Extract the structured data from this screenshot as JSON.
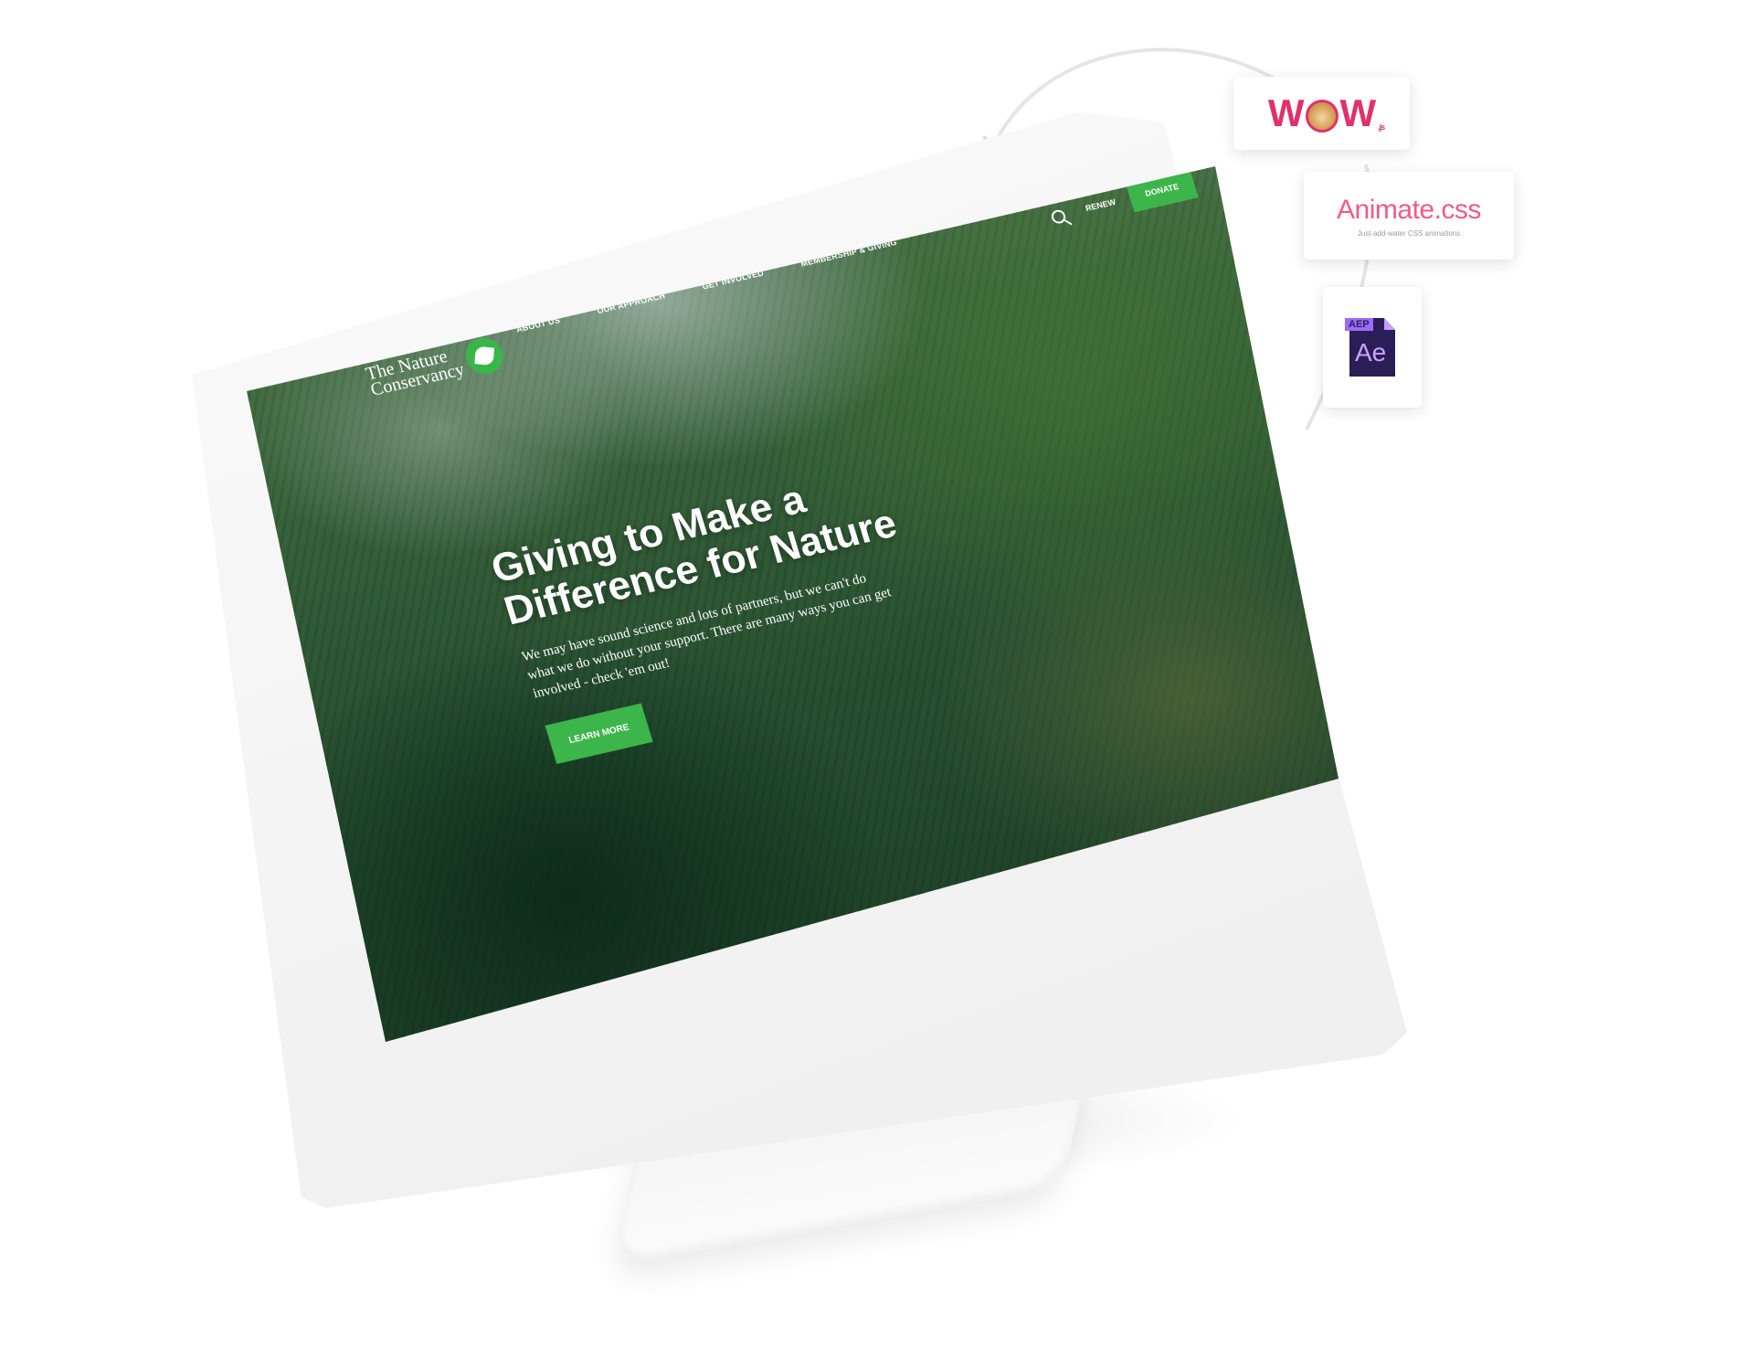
{
  "site": {
    "logo_line1": "The Nature",
    "logo_line2": "Conservancy",
    "nav": [
      {
        "label": "About Us"
      },
      {
        "label": "Our Approach"
      },
      {
        "label": "Get Involved"
      },
      {
        "label": "Membership & Giving"
      }
    ],
    "renew_label": "RENEW",
    "donate_label": "DONATE",
    "hero": {
      "title": "Giving to Make a Difference for Nature",
      "subtitle": "We may have sound science and lots of partners, but we can't do what we do without your support. There are many ways you can get involved - check 'em out!",
      "cta_label": "LEARN MORE"
    },
    "accent_color": "#3cb54a"
  },
  "tools": {
    "wow": {
      "label": "WOW",
      "suffix": ".js"
    },
    "animate": {
      "title": "Animate.css",
      "tagline": "Just-add-water CSS animations"
    },
    "after_effects": {
      "tag": "AEP",
      "letters": "Ae"
    }
  }
}
